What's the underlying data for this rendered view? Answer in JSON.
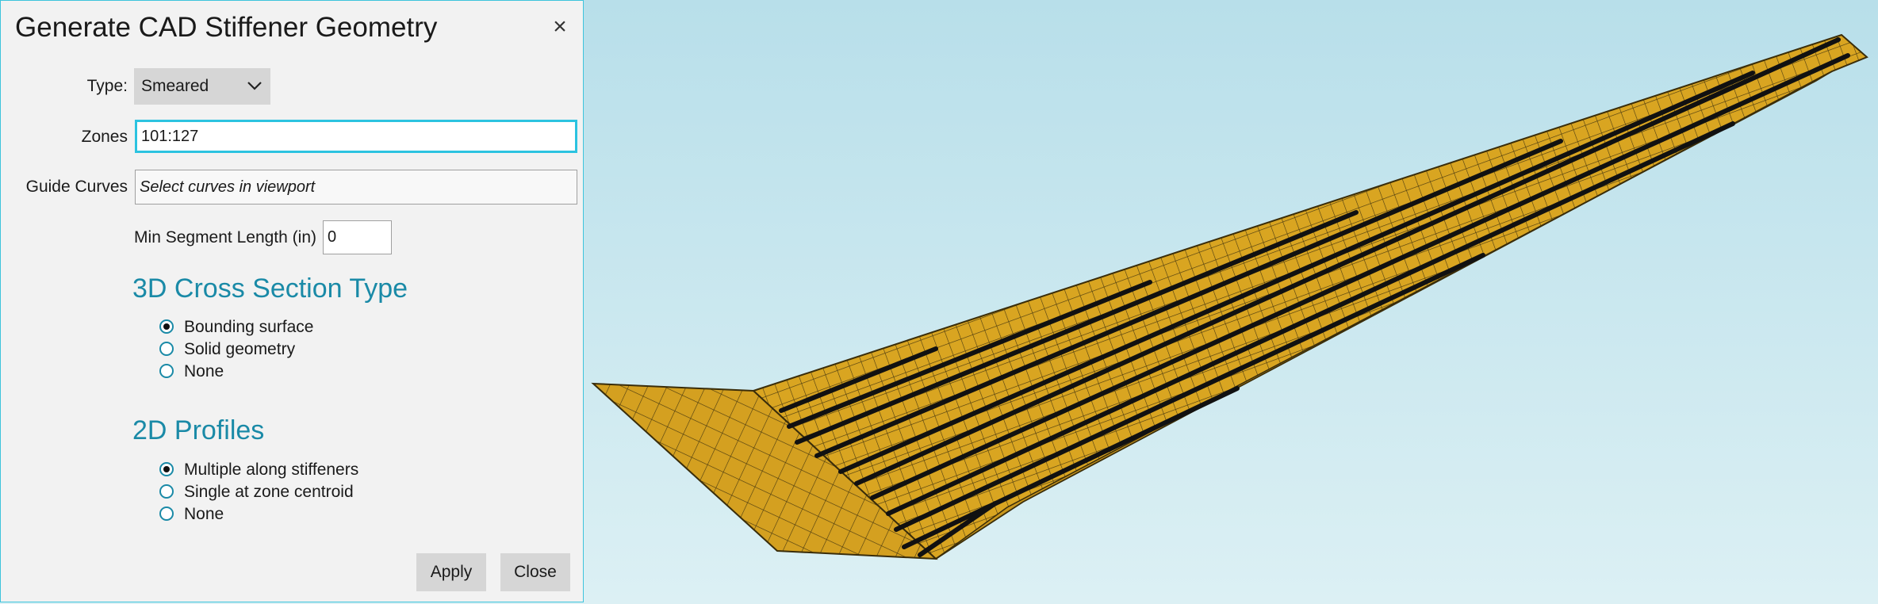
{
  "dialog": {
    "title": "Generate CAD Stiffener Geometry",
    "type_label": "Type:",
    "type_value": "Smeared",
    "zones_label": "Zones",
    "zones_value": "101:127",
    "guide_curves_label": "Guide Curves",
    "guide_curves_placeholder": "Select curves in viewport",
    "min_segment_label": "Min Segment Length (in)",
    "min_segment_value": "0",
    "cross_section": {
      "heading": "3D Cross Section Type",
      "options": [
        {
          "label": "Bounding surface",
          "selected": true
        },
        {
          "label": "Solid geometry",
          "selected": false
        },
        {
          "label": "None",
          "selected": false
        }
      ]
    },
    "profiles": {
      "heading": "2D Profiles",
      "options": [
        {
          "label": "Multiple along stiffeners",
          "selected": true
        },
        {
          "label": "Single at zone centroid",
          "selected": false
        },
        {
          "label": "None",
          "selected": false
        }
      ]
    },
    "apply_label": "Apply",
    "close_label": "Close"
  },
  "icons": {
    "close": "close-icon",
    "dropdown": "chevron-down-icon"
  },
  "colors": {
    "accent": "#1a8aa7",
    "focus_border": "#2cc3e0",
    "wing_fill": "#d9a521",
    "stiffener": "#111111"
  }
}
